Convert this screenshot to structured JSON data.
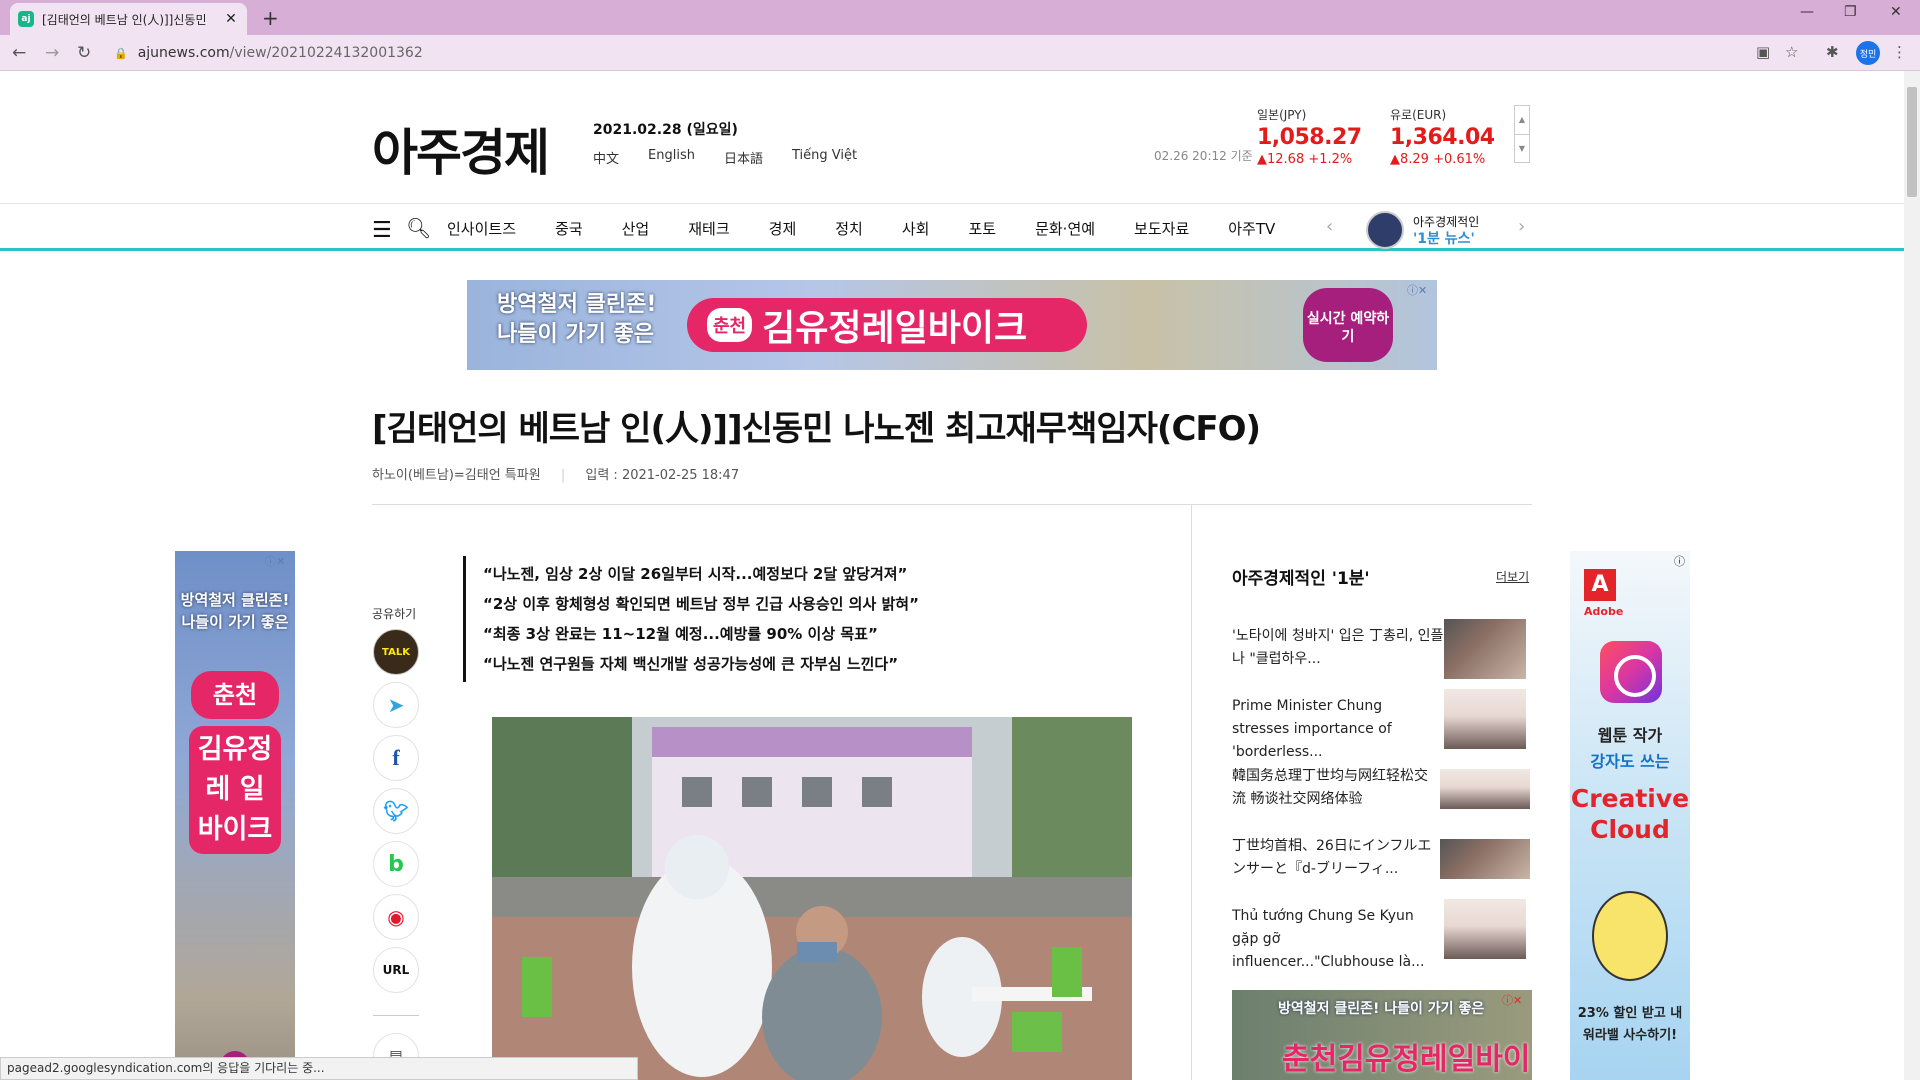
{
  "browser": {
    "tab_title": "[김태언의 베트남 인(人)]]신동민",
    "tab_favicon": "ajunews-favicon-icon",
    "url_host": "ajunews.com",
    "url_path": "/view/20210224132001362",
    "profile_label": "정민"
  },
  "site": {
    "logo": "아주경제",
    "date": "2021.02.28 (일요일)",
    "languages": [
      "中文",
      "English",
      "日本語",
      "Tiếng Việt"
    ],
    "fx_timestamp": "02.26 20:12 기준",
    "fx": [
      {
        "label": "일본(JPY)",
        "value": "1,058.27",
        "change": "▲12.68  +1.2%"
      },
      {
        "label": "유로(EUR)",
        "value": "1,364.04",
        "change": "▲8.29  +0.61%"
      }
    ],
    "menu": [
      "인사이트즈",
      "중국",
      "산업",
      "재테크",
      "경제",
      "정치",
      "사회",
      "포토",
      "문화·연예",
      "보도자료",
      "아주TV"
    ],
    "minute_label": "아주경제적인",
    "minute_title": "'1분 뉴스'"
  },
  "ads": {
    "top_line1": "방역철저 클린존!",
    "top_line2": "나들이 가기 좋은",
    "top_brand_small": "춘천",
    "top_brand": "김유정레일바이크",
    "top_cta": "실시간 예약하기",
    "left_line1": "방역철저 클린존!",
    "left_line2": "나들이 가기 좋은",
    "left_brand_small": "춘천",
    "left_brand": "김유정 레 일 바이크",
    "right_line1": "방역철저 클린존! 나들이 가기 좋은",
    "right_brand": "춘천김유정레일바이크",
    "adobe_brand": "Adobe",
    "adobe_line1": "웹툰 작가",
    "adobe_line2": "강자도 쓰는",
    "adobe_product": "Creative Cloud",
    "adobe_offer": "23% 할인 받고 내 워라밸 사수하기!"
  },
  "article": {
    "headline": "[김태언의 베트남 인(人)]]신동민 나노젠 최고재무책임자(CFO)",
    "byline": "하노이(베트남)=김태언 특파원",
    "published": "입력 : 2021-02-25 18:47",
    "share_label": "공유하기",
    "share_buttons": [
      "kakaotalk",
      "telegram",
      "facebook",
      "twitter",
      "band",
      "weibo",
      "URL"
    ],
    "quotes": [
      "“나노젠, 임상 2상 이달 26일부터 시작...예정보다 2달 앞당겨져”",
      "“2상 이후 항체형성 확인되면 베트남 정부 긴급 사용승인 의사 밝혀”",
      "“최종 3상 완료는 11~12월 예정...예방률 90% 이상 목표”",
      "“나노젠 연구원들 자체 백신개발 성공가능성에 큰 자부심 느낀다”"
    ]
  },
  "sidebar": {
    "title": "아주경제적인 '1분'",
    "more": "더보기",
    "items": [
      "'노타이에 청바지' 입은 丁총리, 인플루언서 만나 \"클럽하우...",
      "Prime Minister Chung stresses importance of 'borderless...",
      "韓国务总理丁世均与网红轻松交流 畅谈社交网络体验",
      "丁世均首相、26日にインフルエンサーと『d-ブリーフィ...",
      "Thủ tướng Chung Se Kyun gặp gỡ influencer...\"Clubhouse là..."
    ]
  },
  "status_text": "pagead2.googlesyndication.com의 응답을 기다리는 중..."
}
